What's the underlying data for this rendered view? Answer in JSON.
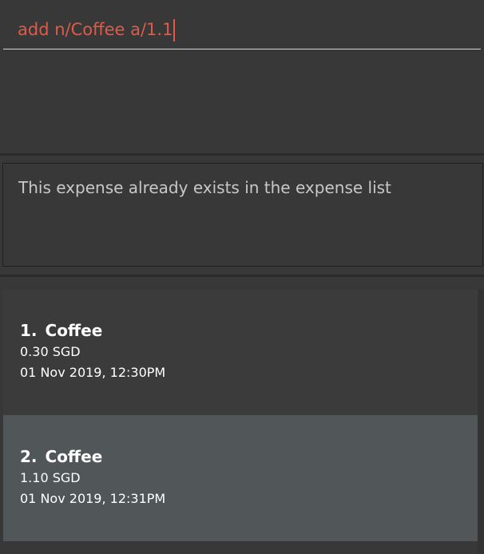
{
  "command": {
    "value": "add n/Coffee a/1.1"
  },
  "result": {
    "message": "This expense already exists in the expense list"
  },
  "expenses": [
    {
      "index": "1.",
      "name": "Coffee",
      "amount": "0.30 SGD",
      "timestamp": "01 Nov 2019, 12:30PM"
    },
    {
      "index": "2.",
      "name": "Coffee",
      "amount": "1.10 SGD",
      "timestamp": "01 Nov 2019, 12:31PM"
    }
  ],
  "colors": {
    "background": "#383838",
    "command_text": "#e05a47",
    "card_selected": "#515658"
  }
}
